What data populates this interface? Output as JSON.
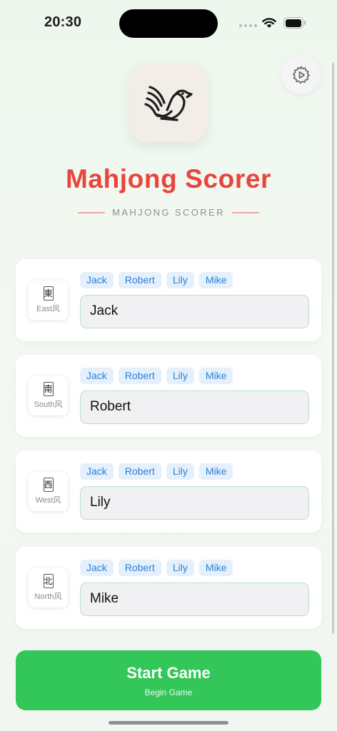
{
  "status_bar": {
    "time": "20:30"
  },
  "header": {
    "title": "Mahjong Scorer",
    "subtitle": "MAHJONG SCORER"
  },
  "players": [
    {
      "wind_tile": "東",
      "wind_label": "East风",
      "name": "Jack"
    },
    {
      "wind_tile": "南",
      "wind_label": "South风",
      "name": "Robert"
    },
    {
      "wind_tile": "西",
      "wind_label": "West风",
      "name": "Lily"
    },
    {
      "wind_tile": "北",
      "wind_label": "North风",
      "name": "Mike"
    }
  ],
  "name_suggestions": [
    "Jack",
    "Robert",
    "Lily",
    "Mike"
  ],
  "start_button": {
    "label": "Start Game",
    "sublabel": "Begin Game"
  },
  "icons": {
    "settings": "gear-play-icon",
    "logo": "bird-icon",
    "wifi": "wifi-icon",
    "battery": "battery-icon"
  },
  "colors": {
    "title": "#e8453c",
    "primary": "#33c759",
    "chip_text": "#2b7fd6",
    "chip_bg": "#e5f0fb",
    "input_border": "#b9e2c4"
  }
}
